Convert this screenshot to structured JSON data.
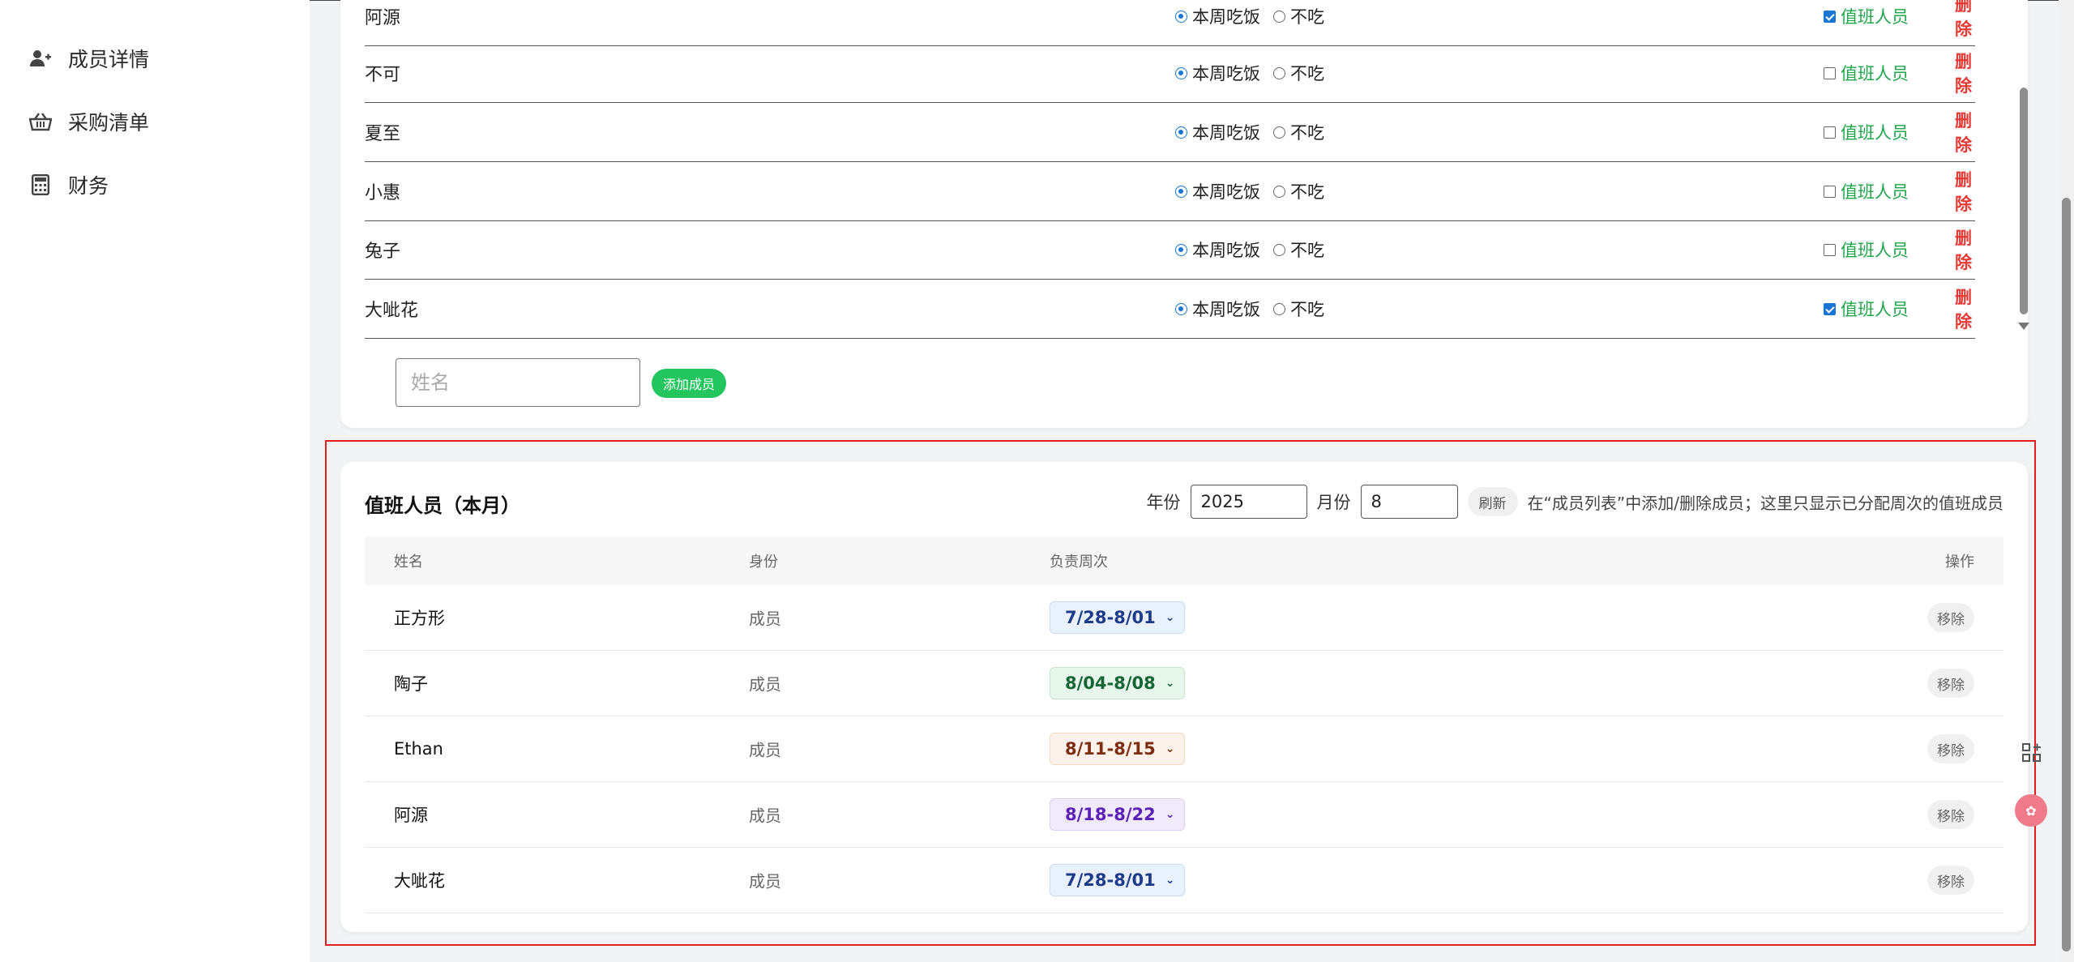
{
  "sidebar": {
    "items": [
      {
        "label": "成员详情",
        "icon": "user-plus-icon"
      },
      {
        "label": "采购清单",
        "icon": "basket-icon"
      },
      {
        "label": "财务",
        "icon": "calculator-icon"
      }
    ]
  },
  "members": {
    "rows": [
      {
        "name": "阿源",
        "eat_label": "本周吃饭",
        "no_eat_label": "不吃",
        "eat": true,
        "duty_label": "值班人员",
        "duty": true,
        "delete_label": "删除"
      },
      {
        "name": "不可",
        "eat_label": "本周吃饭",
        "no_eat_label": "不吃",
        "eat": true,
        "duty_label": "值班人员",
        "duty": false,
        "delete_label": "删除"
      },
      {
        "name": "夏至",
        "eat_label": "本周吃饭",
        "no_eat_label": "不吃",
        "eat": true,
        "duty_label": "值班人员",
        "duty": false,
        "delete_label": "删除"
      },
      {
        "name": "小惠",
        "eat_label": "本周吃饭",
        "no_eat_label": "不吃",
        "eat": true,
        "duty_label": "值班人员",
        "duty": false,
        "delete_label": "删除"
      },
      {
        "name": "兔子",
        "eat_label": "本周吃饭",
        "no_eat_label": "不吃",
        "eat": true,
        "duty_label": "值班人员",
        "duty": false,
        "delete_label": "删除"
      },
      {
        "name": "大呲花",
        "eat_label": "本周吃饭",
        "no_eat_label": "不吃",
        "eat": true,
        "duty_label": "值班人员",
        "duty": true,
        "delete_label": "删除"
      }
    ],
    "name_placeholder": "姓名",
    "add_label": "添加成员"
  },
  "duty": {
    "title": "值班人员（本月）",
    "year_label": "年份",
    "year_value": "2025",
    "month_label": "月份",
    "month_value": "8",
    "refresh_label": "刷新",
    "hint": "在“成员列表”中添加/删除成员；这里只显示已分配周次的值班成员",
    "headers": {
      "name": "姓名",
      "role": "身份",
      "week": "负责周次",
      "action": "操作"
    },
    "rows": [
      {
        "name": "正方形",
        "role": "成员",
        "week": "7/28-8/01",
        "color": "#1e3a8a",
        "bg": "#e8f1fc",
        "border": "#c7dcf5",
        "action": "移除"
      },
      {
        "name": "陶子",
        "role": "成员",
        "week": "8/04-8/08",
        "color": "#166534",
        "bg": "#e7f6ea",
        "border": "#c5e8cc",
        "action": "移除"
      },
      {
        "name": "Ethan",
        "role": "成员",
        "week": "8/11-8/15",
        "color": "#7c2d12",
        "bg": "#fdf2e9",
        "border": "#f3d9c2",
        "action": "移除"
      },
      {
        "name": "阿源",
        "role": "成员",
        "week": "8/18-8/22",
        "color": "#5b21b6",
        "bg": "#f1eafc",
        "border": "#ddd0f5",
        "action": "移除"
      },
      {
        "name": "大呲花",
        "role": "成员",
        "week": "7/28-8/01",
        "color": "#1e3a8a",
        "bg": "#e8f1fc",
        "border": "#c7dcf5",
        "action": "移除"
      }
    ]
  },
  "colors": {
    "accent": "#22c55e",
    "danger": "#e53935",
    "highlight": "#e02020",
    "radio": "#1976d2"
  }
}
